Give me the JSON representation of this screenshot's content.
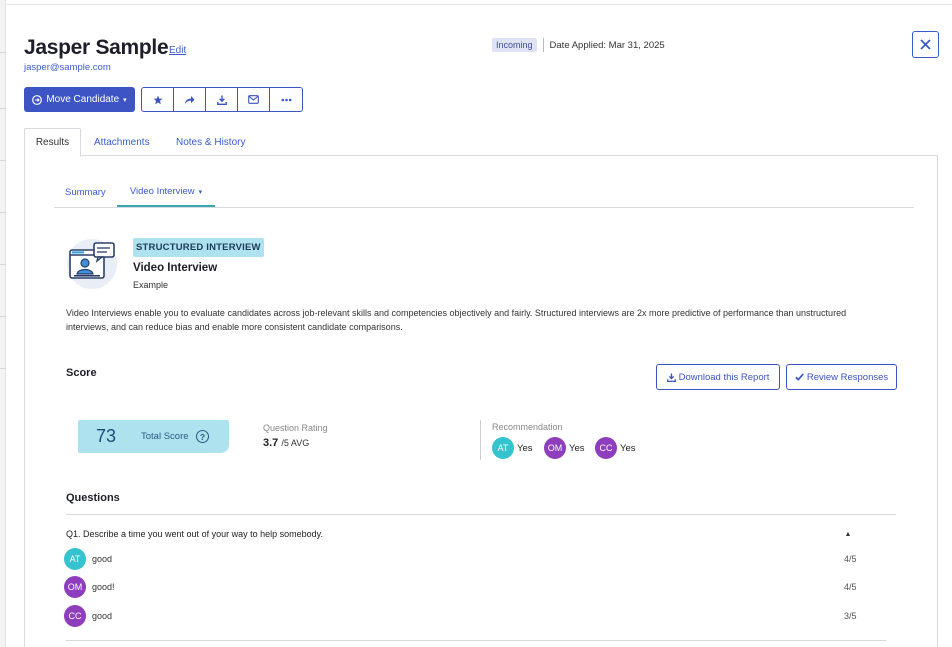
{
  "candidate": {
    "name": "Jasper Sample",
    "edit_label": "Edit",
    "email": "jasper@sample.com"
  },
  "status": {
    "badge": "Incoming",
    "date_applied": "Date Applied: Mar 31, 2025"
  },
  "toolbar": {
    "move_label": "Move Candidate",
    "actions": [
      "star-icon",
      "share-icon",
      "download-icon",
      "email-icon",
      "more-icon"
    ]
  },
  "tabs": [
    {
      "label": "Results"
    },
    {
      "label": "Attachments"
    },
    {
      "label": "Notes & History"
    }
  ],
  "subtabs": [
    {
      "label": "Summary"
    },
    {
      "label": "Video Interview"
    }
  ],
  "assessment": {
    "badge": "STRUCTURED INTERVIEW",
    "title": "Video Interview",
    "subtitle": "Example",
    "description": "Video Interviews enable you to evaluate candidates across job-relevant skills and competencies objectively and fairly. Structured interviews are 2x more predictive of performance than unstructured interviews, and can reduce bias and enable more consistent candidate comparisons."
  },
  "score": {
    "section_title": "Score",
    "download_label": "Download this Report",
    "review_label": "Review Responses",
    "total": "73",
    "total_label": "Total Score",
    "rating_label": "Question Rating",
    "rating_value": "3.7",
    "rating_suffix": "/5 AVG",
    "recommendation_label": "Recommendation",
    "recommendations": [
      {
        "initials": "AT",
        "value": "Yes"
      },
      {
        "initials": "OM",
        "value": "Yes"
      },
      {
        "initials": "CC",
        "value": "Yes"
      }
    ]
  },
  "questions": {
    "section_title": "Questions",
    "items": [
      {
        "text": "Q1. Describe a time you went out of your way to help somebody.",
        "answers": [
          {
            "initials": "AT",
            "text": "good",
            "score": "4/5"
          },
          {
            "initials": "OM",
            "text": "good!",
            "score": "4/5"
          },
          {
            "initials": "CC",
            "text": "good",
            "score": "3/5"
          }
        ]
      }
    ]
  },
  "colors": {
    "primary": "#3d55c4",
    "accent_teal": "#34c3cf",
    "accent_purple": "#8e3dbc",
    "score_bg": "#aee2ef"
  }
}
